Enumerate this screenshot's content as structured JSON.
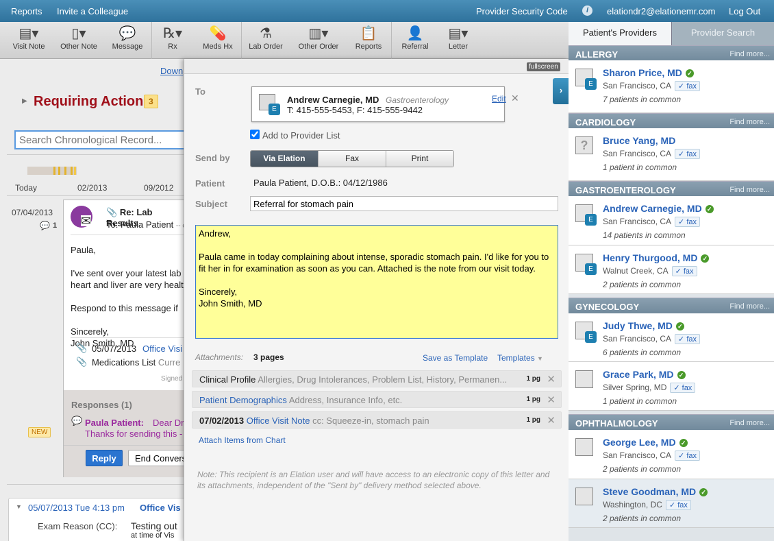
{
  "topbar": {
    "reports": "Reports",
    "invite": "Invite a Colleague",
    "security_code": "Provider Security Code",
    "info_icon": "i",
    "email": "elationdr2@elationemr.com",
    "logout": "Log Out"
  },
  "toolbar": [
    {
      "label": "Visit Note",
      "icon": "▤▾"
    },
    {
      "label": "Other Note",
      "icon": "▯▾"
    },
    {
      "label": "Message",
      "icon": "💬"
    },
    {
      "label": "Rx",
      "icon": "℞▾"
    },
    {
      "label": "Meds Hx",
      "icon": "💊"
    },
    {
      "label": "Lab Order",
      "icon": "⚗"
    },
    {
      "label": "Other Order",
      "icon": "▥▾"
    },
    {
      "label": "Reports",
      "icon": "📋"
    },
    {
      "label": "Referral",
      "icon": "👤"
    },
    {
      "label": "Letter",
      "icon": "▤▾"
    }
  ],
  "left": {
    "download": "Down",
    "requiring_action": "Requiring Action",
    "action_count": "3",
    "search_placeholder": "Search Chronological Record...",
    "timeline": [
      "Today",
      "02/2013",
      "09/2012"
    ],
    "msg_date": "07/04/2013",
    "comment_count": "1",
    "msg_subject": "Re: Lab Results",
    "msg_to": "To: Paula Patient",
    "msg_to_more": "-- c",
    "body": [
      "Paula,",
      "I've sent over your latest lab",
      "heart and liver are very healt",
      "Respond to this message if",
      "Sincerely,",
      "John Smith, MD"
    ],
    "att1_date": "05/07/2013",
    "att1_link": "Office Visi",
    "att2_name": "Medications List",
    "att2_more": "Curre",
    "signed": "Signed",
    "responses": "Responses (1)",
    "new_badge": "NEW",
    "resp_name": "Paula Patient:",
    "resp_text1": "Dear Dr",
    "resp_text2": "Thanks for sending this -",
    "reply": "Reply",
    "end_conv": "End Convers",
    "visit_header_date": "05/07/2013 Tue 4:13 pm",
    "visit_header_type": "Office Vis",
    "exam_label": "Exam Reason (CC):",
    "exam_value": "Testing out",
    "exam_sub": "at time of Vis"
  },
  "modal": {
    "fullscreen": "fullscreen",
    "to_label": "To",
    "recipient": {
      "name": "Andrew Carnegie, MD",
      "specialty": "Gastroenterology",
      "phone": "T: 415-555-5453, F: 415-555-9442",
      "edit": "Edit"
    },
    "add_to_list": "Add to Provider List",
    "add_to_list_checked": true,
    "send_by_label": "Send by",
    "send_by": [
      "Via Elation",
      "Fax",
      "Print"
    ],
    "send_by_selected": "Via Elation",
    "patient_label": "Patient",
    "patient": "Paula Patient, D.O.B.: 04/12/1986",
    "subject_label": "Subject",
    "subject": "Referral for stomach pain",
    "body": "Andrew,\n\nPaula came in today complaining about intense, sporadic stomach pain. I'd like for you to fit her in for examination as soon as you can. Attached is the note from our visit today.\n\nSincerely,\nJohn Smith, MD",
    "attachments_label": "Attachments:",
    "attachments_count": "3 pages",
    "save_template": "Save as Template",
    "templates": "Templates",
    "attachments": [
      {
        "name": "Clinical Profile",
        "desc": "Allergies, Drug Intolerances, Problem List, History, Permanen...",
        "pages": "1 pg"
      },
      {
        "name": "Patient Demographics",
        "desc": "Address, Insurance Info, etc.",
        "pages": "1 pg"
      },
      {
        "date": "07/02/2013",
        "name": "Office Visit Note",
        "desc": "cc: Squeeze-in, stomach pain",
        "pages": "1 pg"
      }
    ],
    "attach_items": "Attach Items from Chart",
    "note": "Note: This recipient is an Elation user and will have access to an electronic copy of this letter and its attachments, independent of the \"Sent by\" delivery method selected above."
  },
  "right": {
    "tabs": [
      "Patient's Providers",
      "Provider Search"
    ],
    "find_more": "Find more...",
    "fax": "✓ fax",
    "categories": [
      {
        "name": "ALLERGY",
        "providers": [
          {
            "name": "Sharon Price, MD",
            "loc": "San Francisco, CA",
            "common": "7 patients in common"
          }
        ]
      },
      {
        "name": "CARDIOLOGY",
        "providers": [
          {
            "name": "Bruce Yang, MD",
            "loc": "San Francisco, CA",
            "common": "1 patient in common"
          }
        ]
      },
      {
        "name": "GASTROENTEROLOGY",
        "providers": [
          {
            "name": "Andrew Carnegie, MD",
            "loc": "San Francisco, CA",
            "common": "14 patients in common"
          },
          {
            "name": "Henry Thurgood, MD",
            "loc": "Walnut Creek, CA",
            "common": "2 patients in common"
          }
        ]
      },
      {
        "name": "GYNECOLOGY",
        "providers": [
          {
            "name": "Judy Thwe, MD",
            "loc": "San Francisco, CA",
            "common": "6 patients in common"
          },
          {
            "name": "Grace Park, MD",
            "loc": "Silver Spring, MD",
            "common": "1 patient in common"
          }
        ]
      },
      {
        "name": "OPHTHALMOLOGY",
        "providers": [
          {
            "name": "George Lee, MD",
            "loc": "San Francisco, CA",
            "common": "2 patients in common"
          },
          {
            "name": "Steve Goodman, MD",
            "loc": "Washington, DC",
            "common": "2 patients in common"
          }
        ]
      }
    ]
  }
}
